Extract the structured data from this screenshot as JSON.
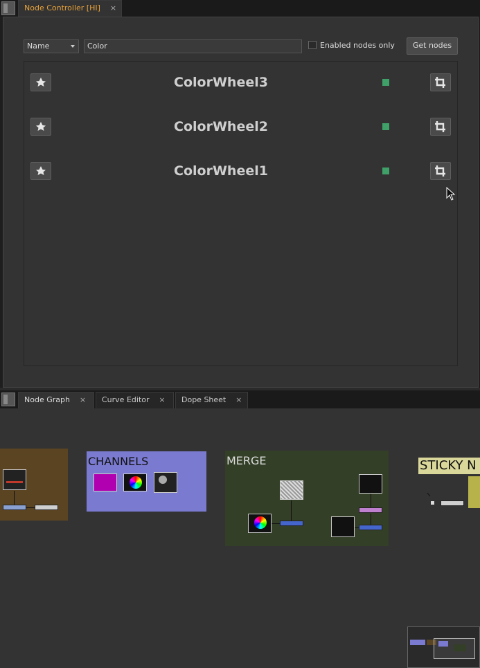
{
  "top_tabs": [
    {
      "label": "Node Controller [HI]",
      "close": "×"
    }
  ],
  "node_controller": {
    "filter_dropdown": {
      "value": "Name"
    },
    "search_field": {
      "value": "Color"
    },
    "enabled_only": {
      "label": "Enabled nodes only",
      "checked": false
    },
    "get_nodes_label": "Get nodes",
    "nodes": [
      {
        "name": "ColorWheel3",
        "enabled": true
      },
      {
        "name": "ColorWheel2",
        "enabled": true
      },
      {
        "name": "ColorWheel1",
        "enabled": true
      }
    ],
    "status_color": "#3fa068"
  },
  "bottom_tabs": [
    {
      "label": "Node Graph",
      "close": "×"
    },
    {
      "label": "Curve Editor",
      "close": "×"
    },
    {
      "label": "Dope Sheet",
      "close": "×"
    }
  ],
  "node_graph": {
    "backdrops": [
      {
        "label": ""
      },
      {
        "label": "CHANNELS",
        "color": "#7a7ad0"
      },
      {
        "label": "MERGE",
        "color": "#333f26"
      },
      {
        "label": "STICKY N",
        "color": "#d9d79a"
      }
    ]
  }
}
